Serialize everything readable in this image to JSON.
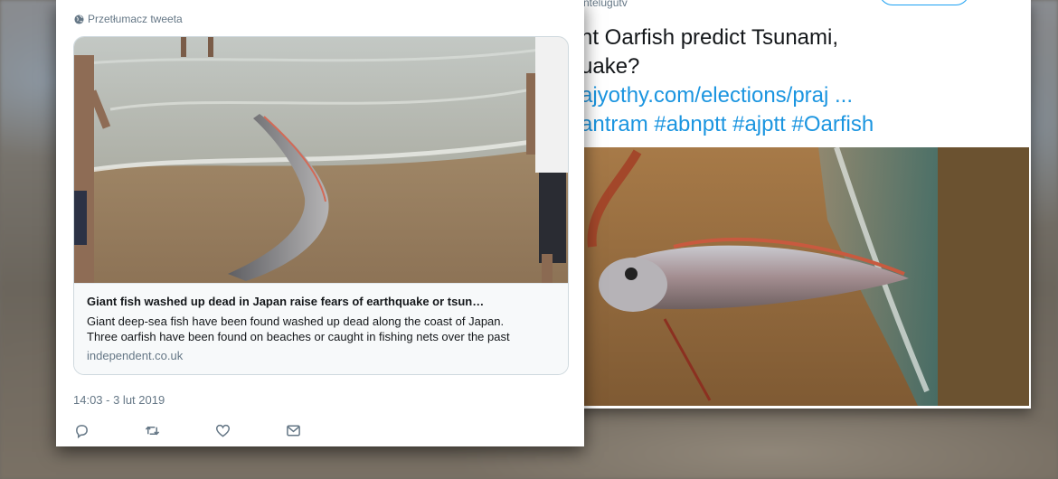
{
  "background": {
    "description_color": "#6f6a63"
  },
  "back_tweet": {
    "username_fragment": "ntelugutv",
    "lines": [
      "nt Oarfish predict Tsunami,",
      "uake?"
    ],
    "link_lines": [
      "ajyothy.com/elections/praj ...",
      "antram #abnptt #ajptt #Oarfish"
    ],
    "link_color": "#1b95e0"
  },
  "front_tweet": {
    "translate_label": "Przetłumacz tweeta",
    "card": {
      "title": "Giant fish washed up dead in Japan raise fears of earthquake or tsun…",
      "description_lines": [
        "Giant deep-sea fish have been found washed up dead along the coast of Japan.",
        "Three oarfish have been found on beaches or caught in fishing nets over the past"
      ],
      "domain": "independent.co.uk"
    },
    "timestamp": "14:03 - 3 lut 2019",
    "actions": [
      {
        "name": "reply",
        "icon": "reply-icon"
      },
      {
        "name": "retweet",
        "icon": "retweet-icon"
      },
      {
        "name": "like",
        "icon": "heart-icon"
      },
      {
        "name": "message",
        "icon": "mail-icon"
      }
    ],
    "accent_color": "#1da1f2",
    "muted_color": "#657786"
  }
}
